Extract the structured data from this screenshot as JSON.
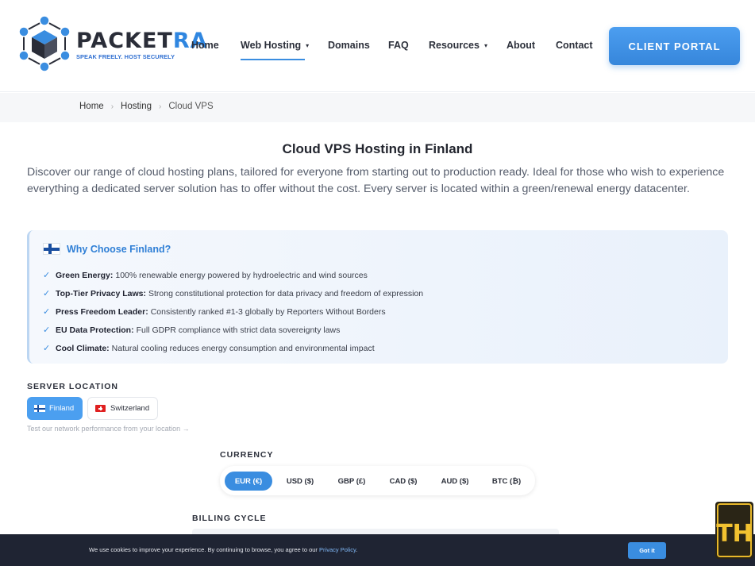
{
  "brand": {
    "name_main": "PACKET",
    "name_accent": "RA",
    "tagline": "SPEAK FREELY. HOST SECURELY",
    "colors": {
      "accent": "#3a8de0",
      "dark": "#2a2d38"
    }
  },
  "nav": {
    "items": [
      {
        "label": "Home"
      },
      {
        "label": "Web Hosting",
        "caret": "▾"
      },
      {
        "label": "Domains"
      },
      {
        "label": "FAQ"
      },
      {
        "label": "Resources",
        "caret": "▾"
      },
      {
        "label": "About"
      },
      {
        "label": "Contact"
      }
    ],
    "portal_button": "CLIENT PORTAL"
  },
  "breadcrumb": {
    "items": [
      "Home",
      "Hosting",
      "Cloud VPS"
    ],
    "separator": "›"
  },
  "main": {
    "title": "Cloud VPS Hosting in Finland",
    "intro": "Discover our range of cloud hosting plans, tailored for everyone from starting out to production ready. Ideal for those who wish to experience everything a dedicated server solution has to offer without the cost. Every server is located within a green/renewal energy datacenter."
  },
  "why": {
    "title": "Why Choose Finland?",
    "check": "✓",
    "items": [
      {
        "label": "Green Energy:",
        "text": "100% renewable energy powered by hydroelectric and wind sources"
      },
      {
        "label": "Top-Tier Privacy Laws:",
        "text": "Strong constitutional protection for data privacy and freedom of expression"
      },
      {
        "label": "Press Freedom Leader:",
        "text": "Consistently ranked #1-3 globally by Reporters Without Borders"
      },
      {
        "label": "EU Data Protection:",
        "text": "Full GDPR compliance with strict data sovereignty laws"
      },
      {
        "label": "Cool Climate:",
        "text": "Natural cooling reduces energy consumption and environmental impact"
      }
    ]
  },
  "server_location": {
    "label": "SERVER LOCATION",
    "options": [
      {
        "label": "Finland",
        "selected": true
      },
      {
        "label": "Switzerland",
        "selected": false
      }
    ],
    "test_link": "Test our network performance from your location →"
  },
  "currency": {
    "label": "CURRENCY",
    "options": [
      "EUR (€)",
      "USD ($)",
      "GBP (£)",
      "CAD ($)",
      "AUD ($)",
      "BTC (₿)"
    ],
    "selected": "EUR (€)"
  },
  "billing": {
    "label": "BILLING CYCLE"
  },
  "cookie": {
    "text": "We use cookies to improve your experience. By continuing to browse, you agree to our",
    "link": "Privacy Policy",
    "period": ".",
    "button": "Got it"
  },
  "watermark": {
    "letters": "TH"
  }
}
